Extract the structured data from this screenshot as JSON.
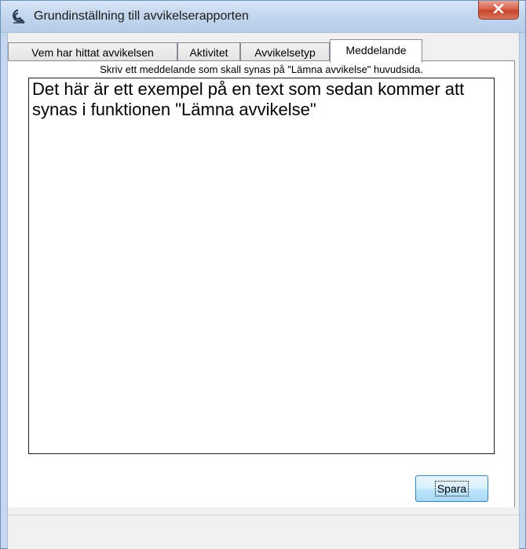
{
  "window": {
    "title": "Grundinställning till avvikelserapporten",
    "close_glyph": "X"
  },
  "tabs": [
    {
      "label": "Vem har hittat avvikelsen",
      "active": false
    },
    {
      "label": "Aktivitet",
      "active": false
    },
    {
      "label": "Avvikelsetyp",
      "active": false
    },
    {
      "label": "Meddelande",
      "active": true
    }
  ],
  "message_tab": {
    "hint": "Skriv ett meddelande som skall synas på \"Lämna avvikelse\" huvudsida.",
    "message_text": "Det här är ett exempel på en text som sedan kommer att synas i funktionen \"Lämna avvikelse\""
  },
  "buttons": {
    "save_label": "Spara"
  },
  "icons": {
    "app": "app-icon",
    "close": "close-icon"
  },
  "colors": {
    "titlebar": "#c4d7ee",
    "close_button": "#d9634d",
    "button_border": "#3c7fb1",
    "background": "#f0f0f0"
  }
}
